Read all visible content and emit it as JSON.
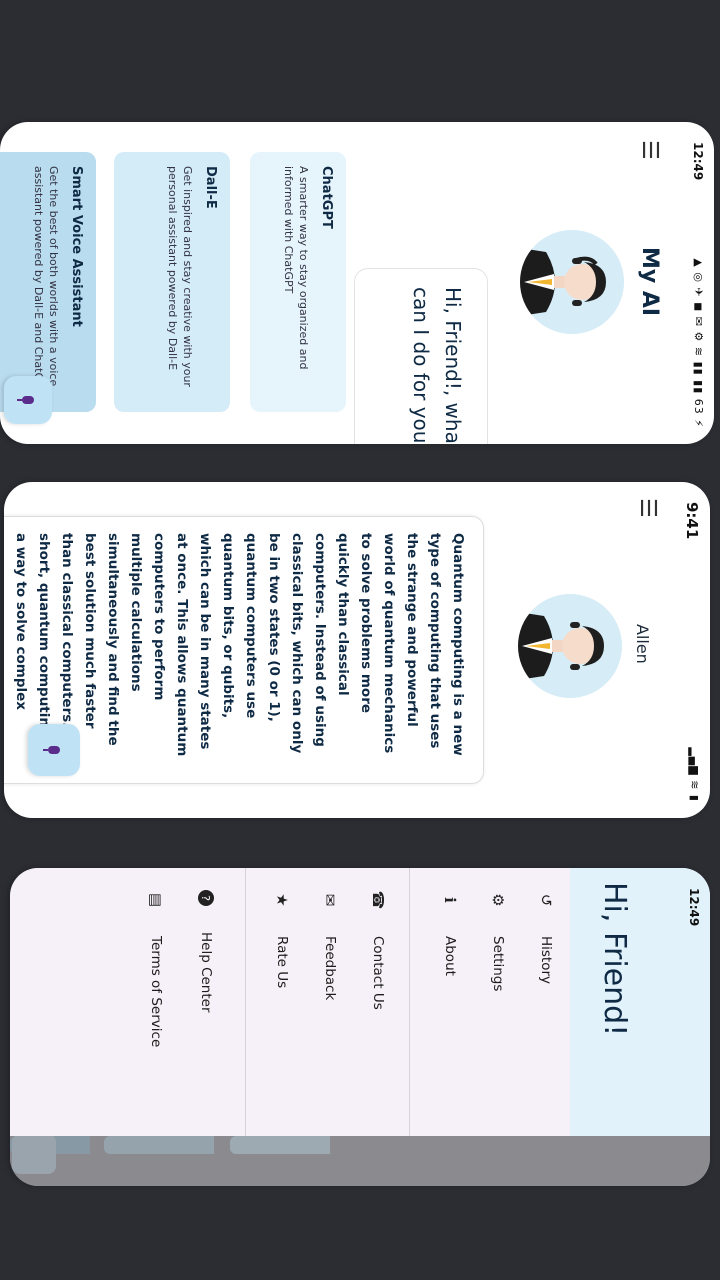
{
  "screen1": {
    "status_time": "12:49",
    "status_icons": "▲ ◎ ✈ ◼ ✉   ⚙ ≋ ▮▮ ▮▮ 63 ⚡",
    "app_title": "My AI",
    "greeting": "Hi, Friend!, what task can I do for you?",
    "cards": [
      {
        "title": "ChatGPT",
        "desc": "A smarter way to stay organized and informed with ChatGPT",
        "color": "#e6f4fc"
      },
      {
        "title": "Dall-E",
        "desc": "Get inspired and stay creative with your personal assistant powered by Dall-E",
        "color": "#d4ebf8"
      },
      {
        "title": "Smart Voice Assistant",
        "desc": "Get the best of both worlds with a voice assistant powered by Dall-E and ChatGPT",
        "color": "#b9dcef"
      }
    ]
  },
  "screen2": {
    "status_time": "9:41",
    "status_icons": "▂▄▆ ≋ ▮",
    "name": "Allen",
    "answer": "Quantum computing is a new type of computing that uses the strange and powerful world of quantum mechanics to solve problems more quickly than classical computers. Instead of using classical bits, which can only be in two states (0 or 1), quantum computers use quantum bits, or qubits, which can be in many states at once. This allows quantum computers to perform multiple calculations simultaneously and find the best solution much faster than classical computers. In short, quantum computing is a way to solve complex"
  },
  "screen3": {
    "status_time": "12:49",
    "status_icons": "▲ ◎ ✈ ◼ ✉   ⚙ ≋ ▮▮ ▮▮ 63 ⚡",
    "drawer_title": "Hi, Friend!",
    "menu_primary": [
      {
        "label": "History",
        "icon": "history-icon",
        "glyph": "↺"
      },
      {
        "label": "Settings",
        "icon": "gear-icon",
        "glyph": "⚙"
      },
      {
        "label": "About",
        "icon": "info-icon",
        "glyph": "ℹ"
      }
    ],
    "menu_secondary": [
      {
        "label": "Contact Us",
        "icon": "contact-icon",
        "glyph": "☎"
      },
      {
        "label": "Feedback",
        "icon": "feedback-icon",
        "glyph": "✉"
      },
      {
        "label": "Rate Us",
        "icon": "star-icon",
        "glyph": "★"
      }
    ],
    "menu_tertiary": [
      {
        "label": "Help Center",
        "icon": "help-icon",
        "glyph": "?"
      },
      {
        "label": "Terms of Service",
        "icon": "document-icon",
        "glyph": "▤"
      }
    ]
  }
}
